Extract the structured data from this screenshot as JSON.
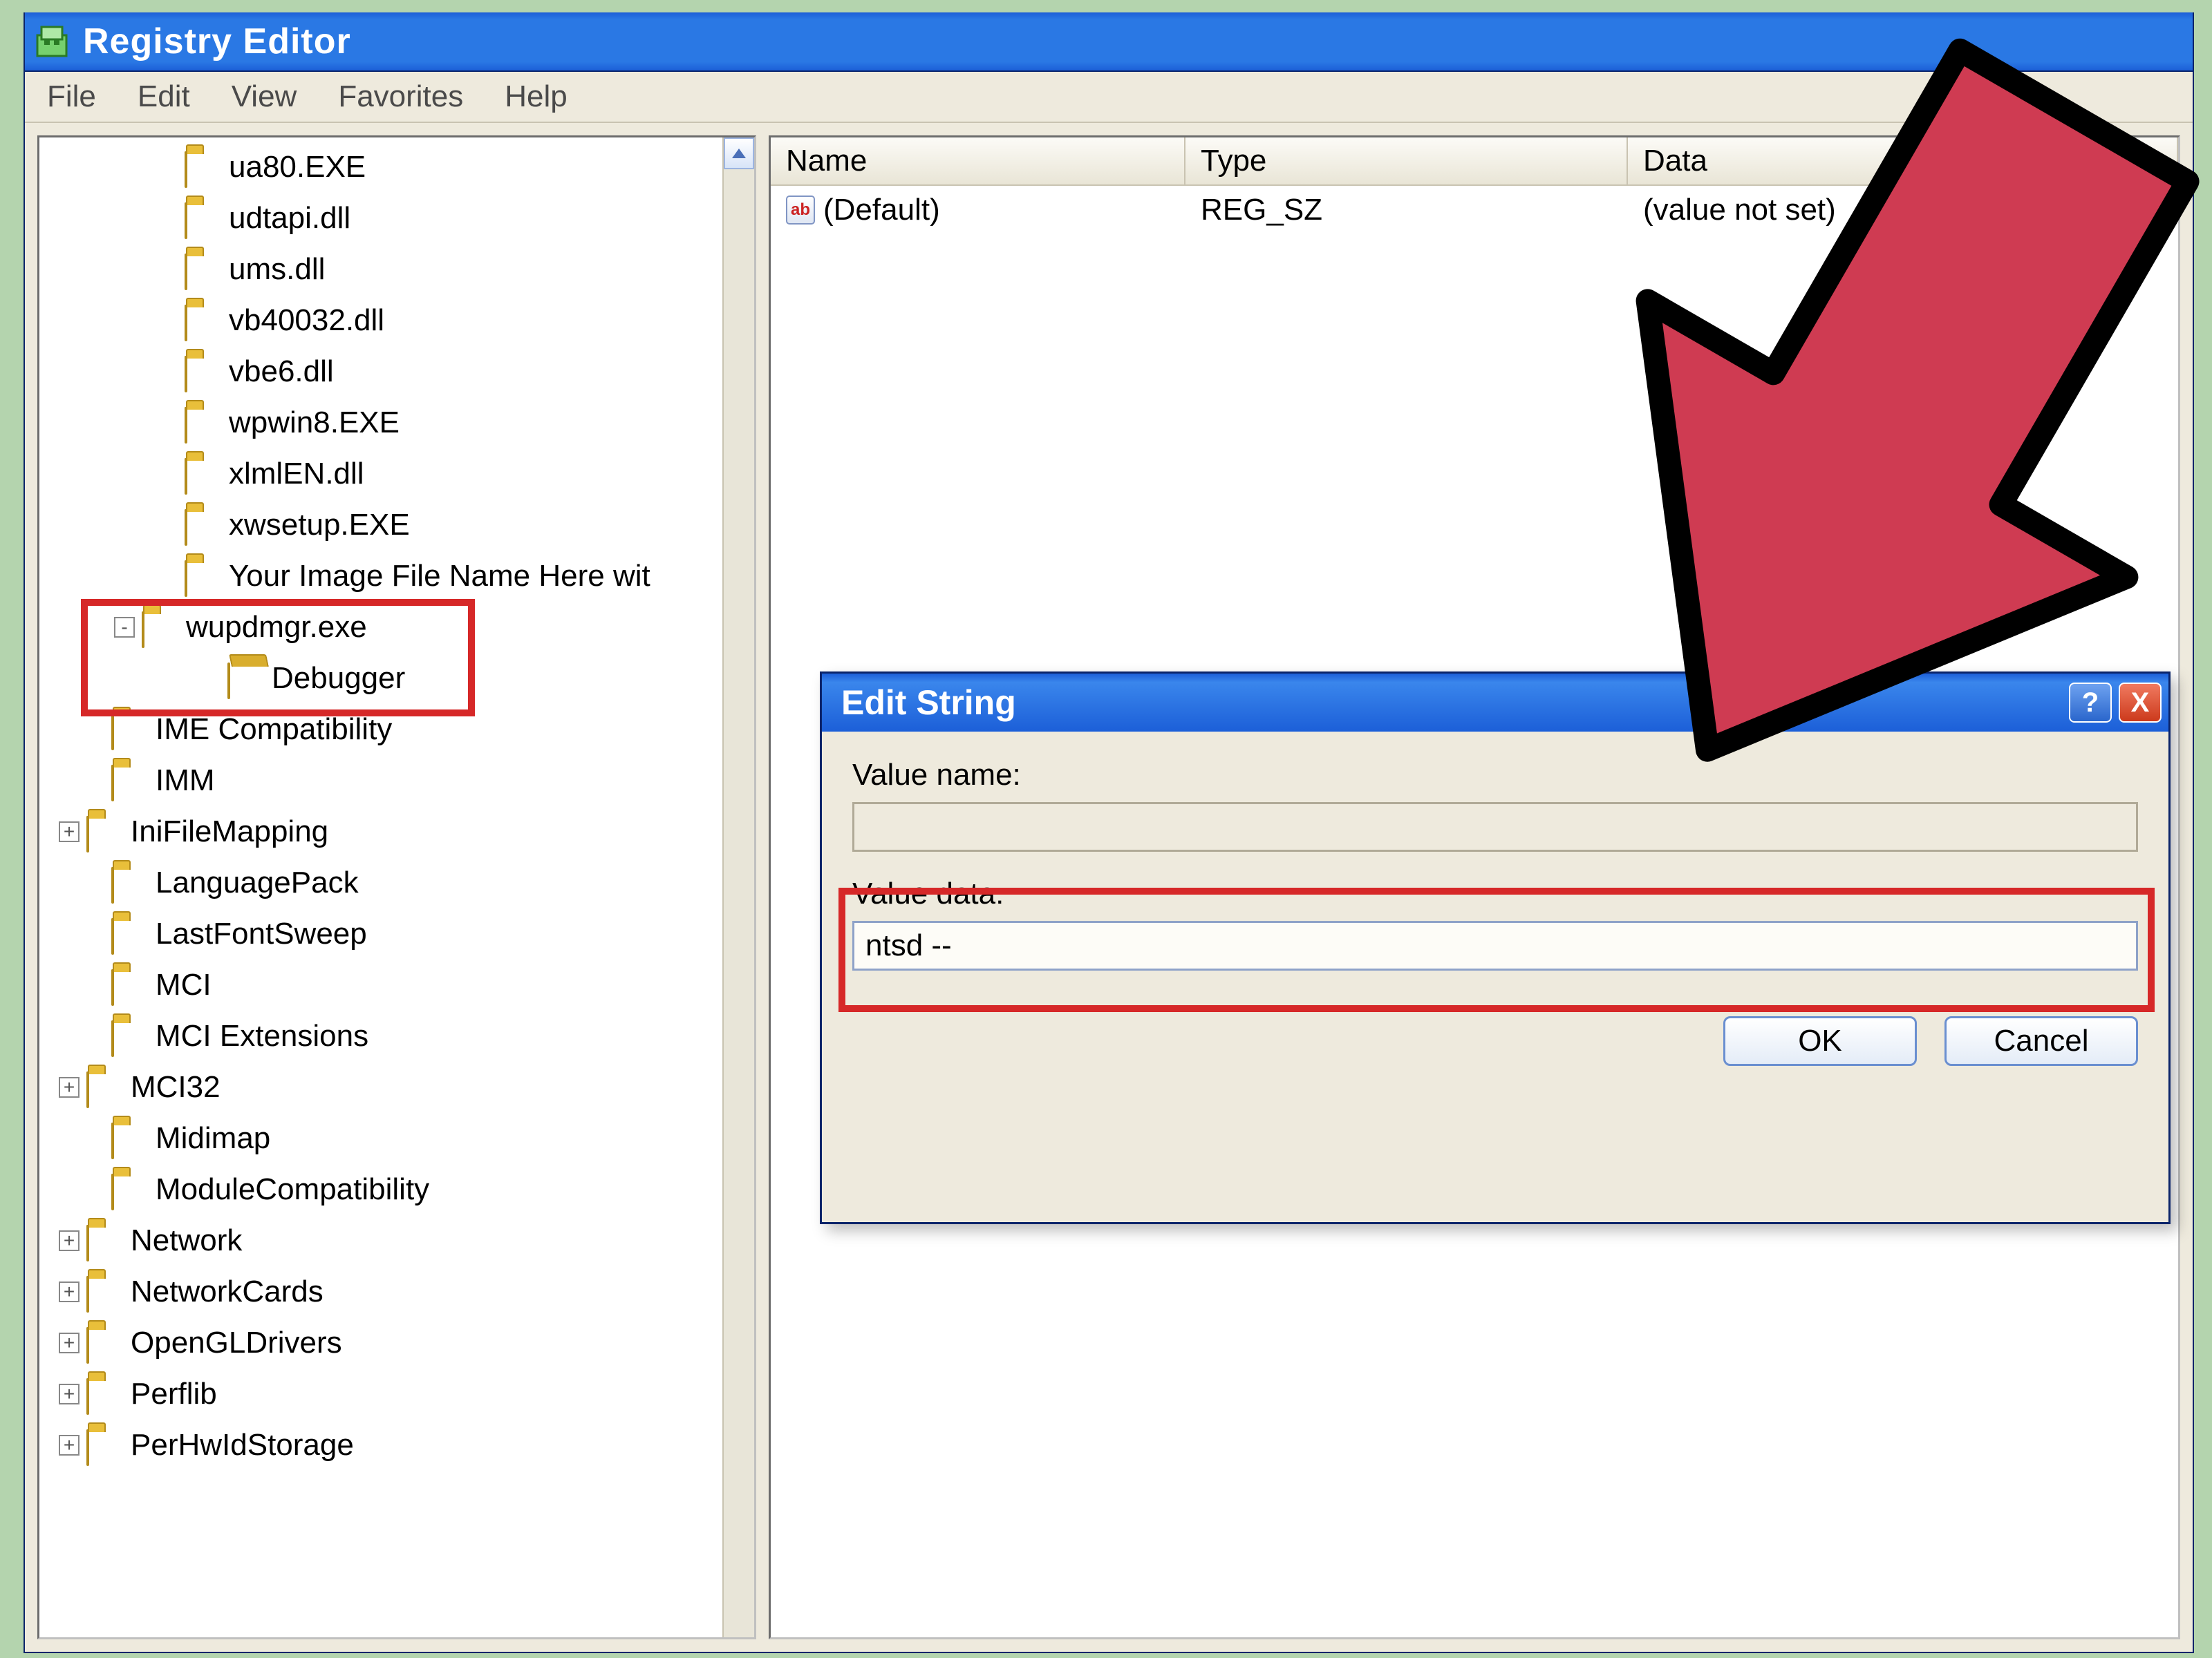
{
  "window": {
    "title": "Registry Editor"
  },
  "menu": {
    "file": "File",
    "edit": "Edit",
    "view": "View",
    "favorites": "Favorites",
    "help": "Help"
  },
  "tree": [
    {
      "indent": 170,
      "expander": "",
      "open": false,
      "label": "ua80.EXE"
    },
    {
      "indent": 170,
      "expander": "",
      "open": false,
      "label": "udtapi.dll"
    },
    {
      "indent": 170,
      "expander": "",
      "open": false,
      "label": "ums.dll"
    },
    {
      "indent": 170,
      "expander": "",
      "open": false,
      "label": "vb40032.dll"
    },
    {
      "indent": 170,
      "expander": "",
      "open": false,
      "label": "vbe6.dll"
    },
    {
      "indent": 170,
      "expander": "",
      "open": false,
      "label": "wpwin8.EXE"
    },
    {
      "indent": 170,
      "expander": "",
      "open": false,
      "label": "xlmlEN.dll"
    },
    {
      "indent": 170,
      "expander": "",
      "open": false,
      "label": "xwsetup.EXE"
    },
    {
      "indent": 170,
      "expander": "",
      "open": false,
      "label": "Your Image File Name Here wit"
    },
    {
      "indent": 108,
      "expander": "-",
      "open": false,
      "label": "wupdmgr.exe"
    },
    {
      "indent": 232,
      "expander": "",
      "open": true,
      "label": "Debugger"
    },
    {
      "indent": 64,
      "expander": "",
      "open": false,
      "label": "IME Compatibility"
    },
    {
      "indent": 64,
      "expander": "",
      "open": false,
      "label": "IMM"
    },
    {
      "indent": 28,
      "expander": "+",
      "open": false,
      "label": "IniFileMapping"
    },
    {
      "indent": 64,
      "expander": "",
      "open": false,
      "label": "LanguagePack"
    },
    {
      "indent": 64,
      "expander": "",
      "open": false,
      "label": "LastFontSweep"
    },
    {
      "indent": 64,
      "expander": "",
      "open": false,
      "label": "MCI"
    },
    {
      "indent": 64,
      "expander": "",
      "open": false,
      "label": "MCI Extensions"
    },
    {
      "indent": 28,
      "expander": "+",
      "open": false,
      "label": "MCI32"
    },
    {
      "indent": 64,
      "expander": "",
      "open": false,
      "label": "Midimap"
    },
    {
      "indent": 64,
      "expander": "",
      "open": false,
      "label": "ModuleCompatibility"
    },
    {
      "indent": 28,
      "expander": "+",
      "open": false,
      "label": "Network"
    },
    {
      "indent": 28,
      "expander": "+",
      "open": false,
      "label": "NetworkCards"
    },
    {
      "indent": 28,
      "expander": "+",
      "open": false,
      "label": "OpenGLDrivers"
    },
    {
      "indent": 28,
      "expander": "+",
      "open": false,
      "label": "Perflib"
    },
    {
      "indent": 28,
      "expander": "+",
      "open": false,
      "label": "PerHwIdStorage"
    }
  ],
  "list": {
    "headers": {
      "name": "Name",
      "type": "Type",
      "data": "Data"
    },
    "rows": [
      {
        "name": "(Default)",
        "type": "REG_SZ",
        "data": "(value not set)"
      }
    ]
  },
  "dialog": {
    "title": "Edit String",
    "value_name_label": "Value name:",
    "value_name": "",
    "value_data_label": "Value data:",
    "value_data": "ntsd --",
    "ok": "OK",
    "cancel": "Cancel",
    "help_glyph": "?",
    "close_glyph": "X"
  },
  "icons": {
    "string_value_glyph": "ab"
  }
}
